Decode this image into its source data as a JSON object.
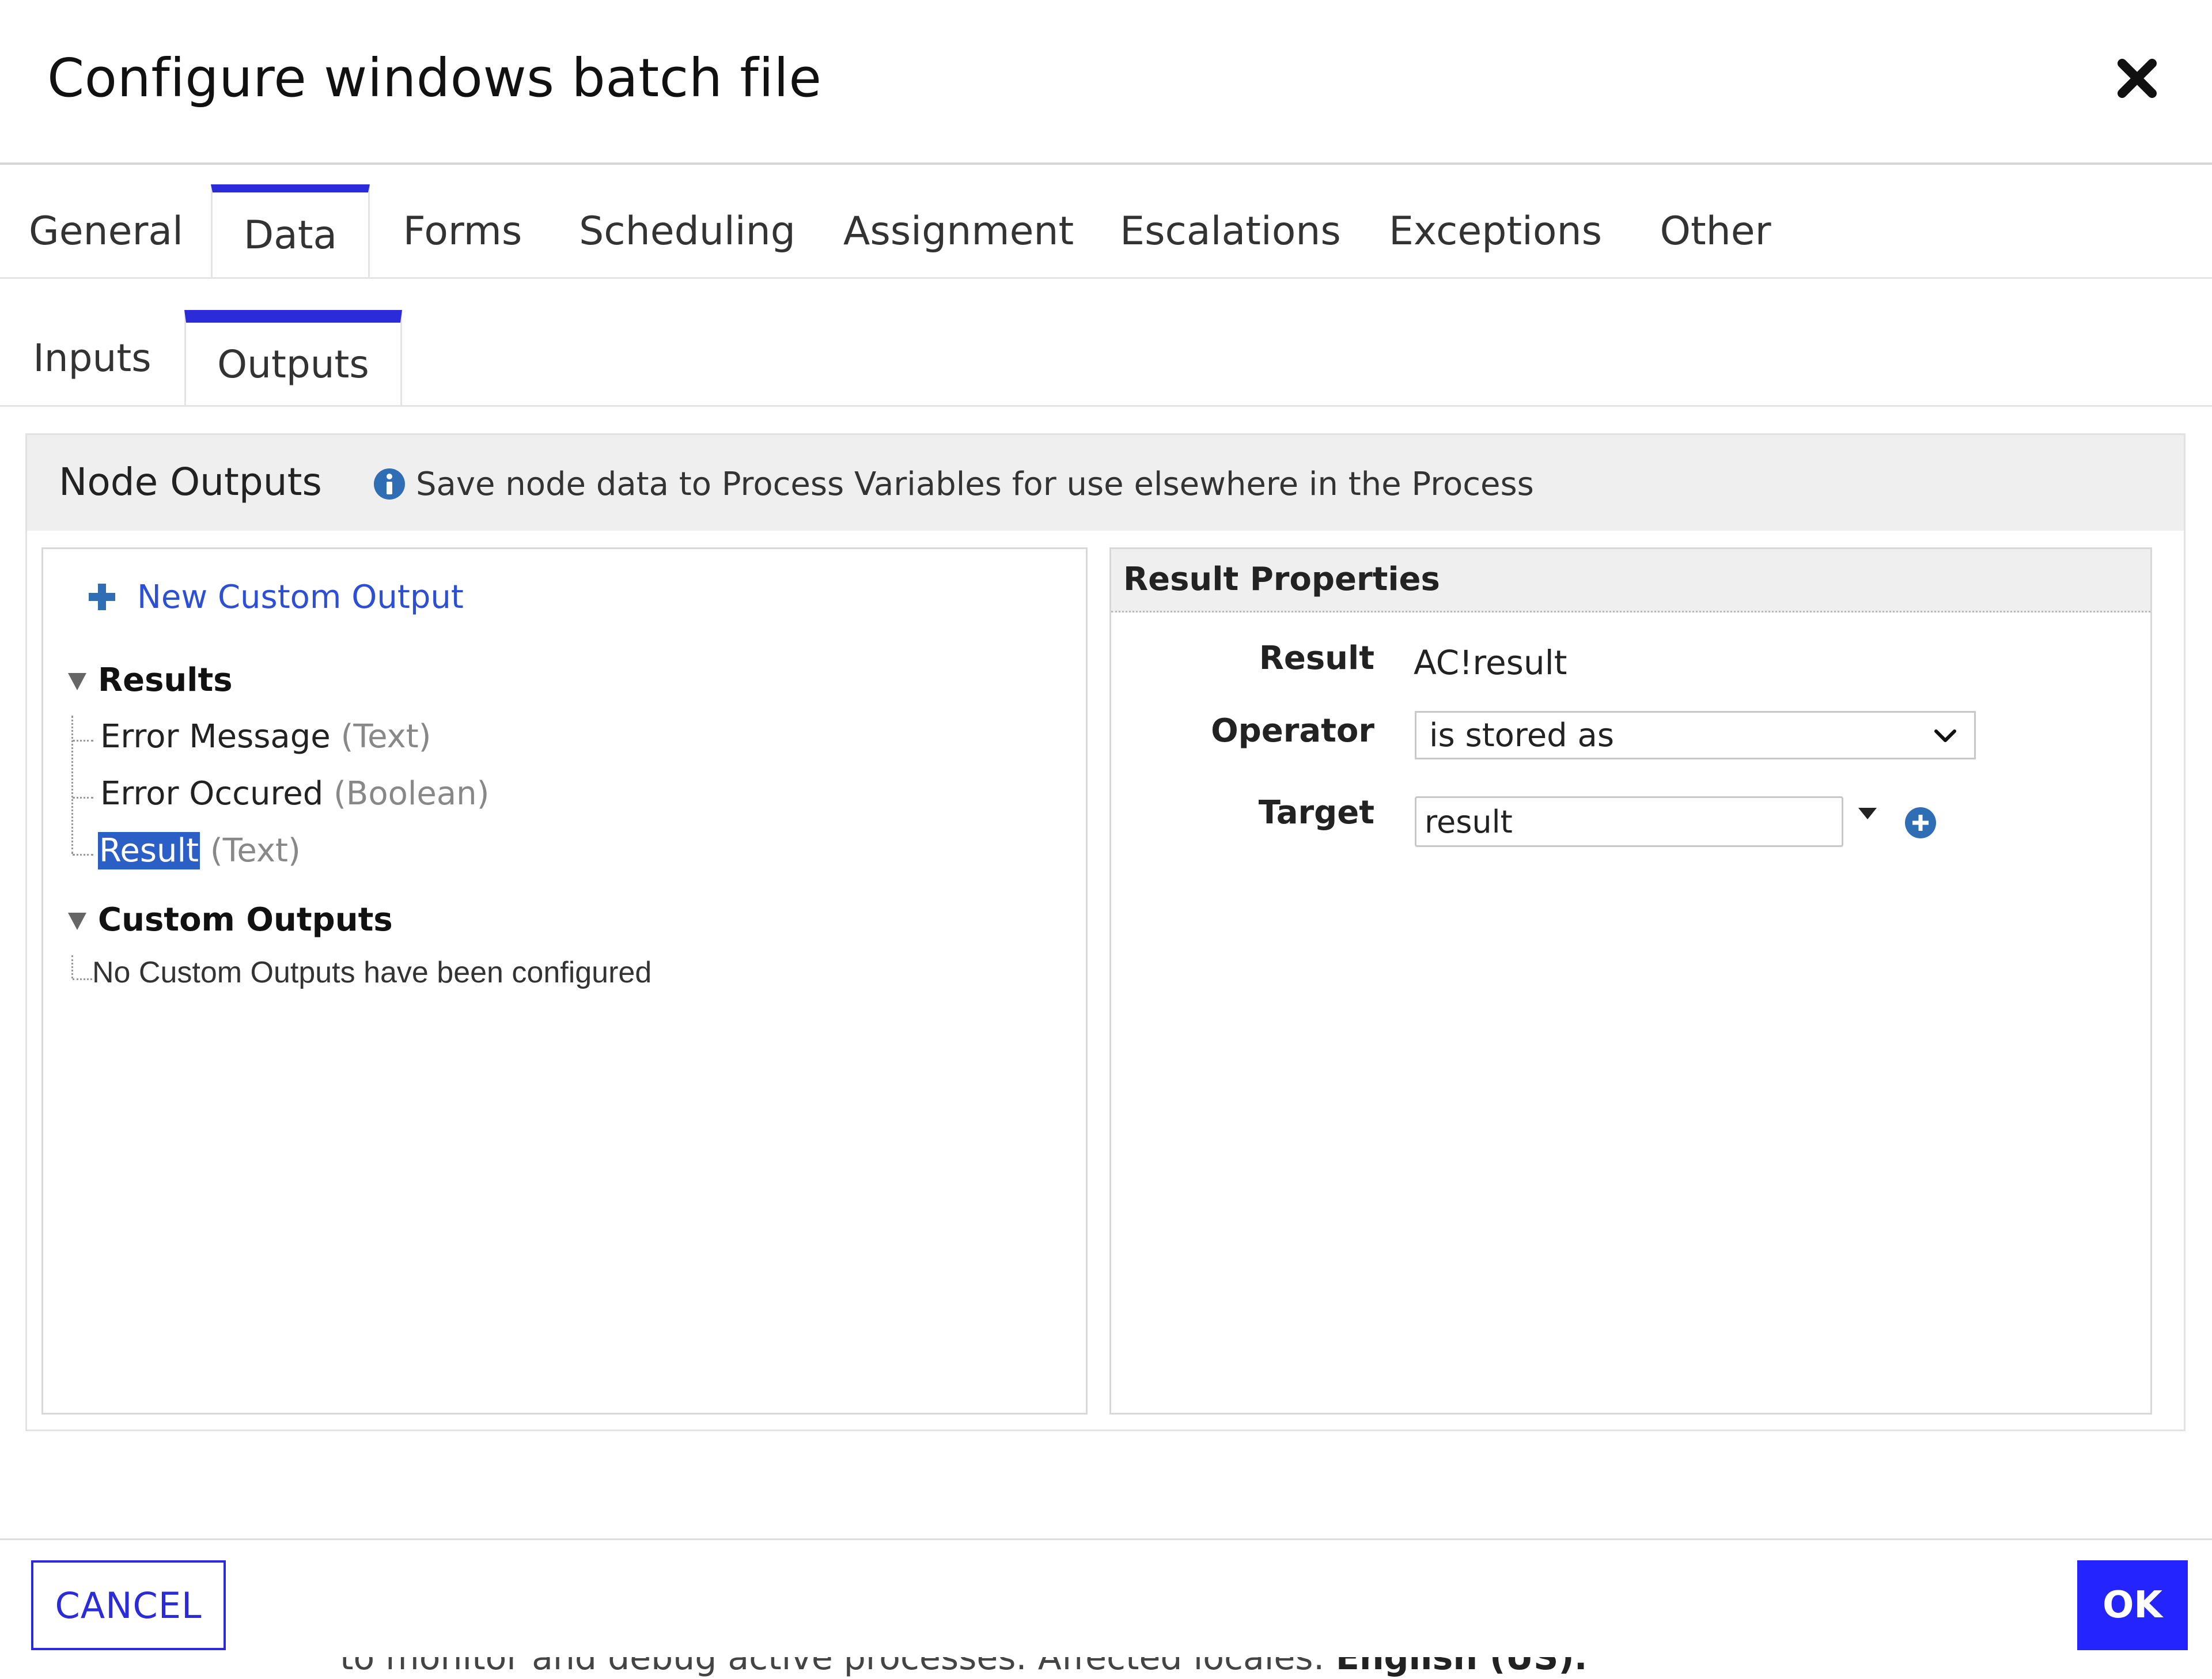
{
  "dialog": {
    "title": "Configure windows batch file"
  },
  "tabs": [
    {
      "label": "General"
    },
    {
      "label": "Data"
    },
    {
      "label": "Forms"
    },
    {
      "label": "Scheduling"
    },
    {
      "label": "Assignment"
    },
    {
      "label": "Escalations"
    },
    {
      "label": "Exceptions"
    },
    {
      "label": "Other"
    }
  ],
  "active_tab": "Data",
  "subtabs": [
    {
      "label": "Inputs"
    },
    {
      "label": "Outputs"
    }
  ],
  "active_subtab": "Outputs",
  "node_outputs": {
    "title": "Node Outputs",
    "info_text": "Save node data to Process Variables for use elsewhere in the Process",
    "new_custom_output_label": "New Custom Output",
    "results_group_label": "Results",
    "results": [
      {
        "name": "Error Message",
        "type": "(Text)"
      },
      {
        "name": "Error Occured",
        "type": "(Boolean)"
      },
      {
        "name": "Result",
        "type": "(Text)"
      }
    ],
    "selected_result": "Result",
    "custom_group_label": "Custom Outputs",
    "custom_empty_text": "No Custom Outputs have been configured"
  },
  "result_properties": {
    "title": "Result Properties",
    "result_label": "Result",
    "result_value": "AC!result",
    "operator_label": "Operator",
    "operator_value": "is stored as",
    "target_label": "Target",
    "target_value": "result"
  },
  "footer": {
    "cancel_label": "CANCEL",
    "ok_label": "OK"
  },
  "background": {
    "partial_text": "to monitor and debug active processes. Affected locales:",
    "partial_bold": "English (US)."
  },
  "colors": {
    "accent": "#2b2bd9",
    "ok_button": "#2424ff",
    "link": "#2d4fd6",
    "selection": "#2b5fc6",
    "info_icon": "#2f6db5"
  },
  "icons": {
    "close": "close-icon",
    "info": "info-icon",
    "plus": "plus-icon",
    "chevron": "chevron-down-icon",
    "add_variable": "add-circle-icon"
  }
}
